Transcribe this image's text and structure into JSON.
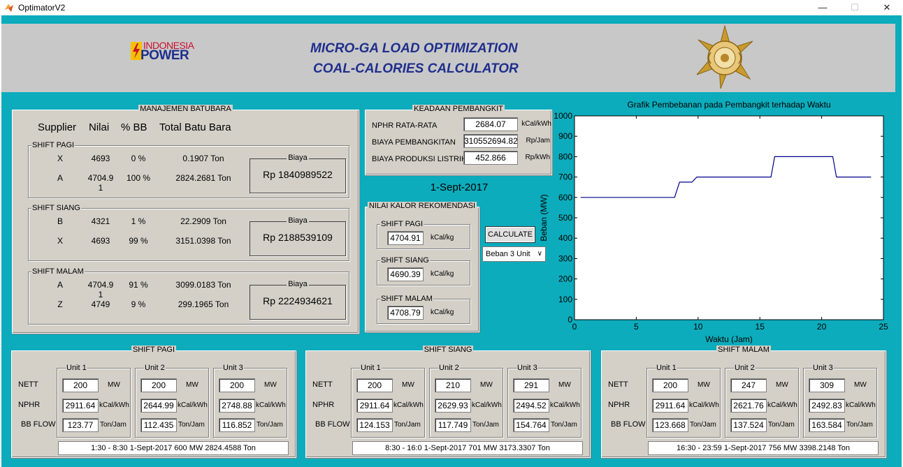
{
  "window": {
    "title": "OptimatorV2",
    "min_icon": "minimize-icon",
    "max_icon": "maximize-icon",
    "close_icon": "close-icon"
  },
  "header": {
    "logo_text_top": "INDONESIA",
    "logo_text_bottom": "POWER",
    "title_line1": "MICRO-GA LOAD OPTIMIZATION",
    "title_line2": "COAL-CALORIES CALCULATOR",
    "emblem_icon": "university-emblem-icon"
  },
  "batubara": {
    "title": "MANAJEMEN BATUBARA",
    "col_supplier": "Supplier",
    "col_nilai": "Nilai",
    "col_bb": "% BB",
    "col_total": "Total Batu Bara",
    "biaya_label": "Biaya",
    "shifts": [
      {
        "label": "SHIFT PAGI",
        "rows": [
          {
            "supplier": "X",
            "nilai": "4693",
            "bb": "0 %",
            "total": "0.1907 Ton"
          },
          {
            "supplier": "A",
            "nilai": "4704.9",
            "nilai2": "1",
            "bb": "100 %",
            "total": "2824.2681 Ton"
          }
        ],
        "biaya": "Rp 1840989522"
      },
      {
        "label": "SHIFT SIANG",
        "rows": [
          {
            "supplier": "B",
            "nilai": "4321",
            "bb": "1 %",
            "total": "22.2909 Ton"
          },
          {
            "supplier": "X",
            "nilai": "4693",
            "bb": "99 %",
            "total": "3151.0398 Ton"
          }
        ],
        "biaya": "Rp 2188539109"
      },
      {
        "label": "SHIFT MALAM",
        "rows": [
          {
            "supplier": "A",
            "nilai": "4704.9",
            "nilai2": "1",
            "bb": "91 %",
            "total": "3099.0183 Ton"
          },
          {
            "supplier": "Z",
            "nilai": "4749",
            "bb": "9 %",
            "total": "299.1965 Ton"
          }
        ],
        "biaya": "Rp 2224934621"
      }
    ]
  },
  "keadaan": {
    "title": "KEADAAN PEMBANGKIT",
    "rows": [
      {
        "label": "NPHR RATA-RATA",
        "value": "2684.07",
        "unit": "kCal/kWh"
      },
      {
        "label": "BIAYA PEMBANGKITAN",
        "value": "310552694.82",
        "unit": "Rp/Jam"
      },
      {
        "label": "BIAYA PRODUKSI LISTRIK",
        "value": "452.866",
        "unit": "Rp/kWh"
      }
    ]
  },
  "date": "1-Sept-2017",
  "kalor": {
    "title": "NILAI KALOR REKOMENDASI",
    "unit": "kCal/kg",
    "shifts": [
      {
        "label": "SHIFT PAGI",
        "value": "4704.91"
      },
      {
        "label": "SHIFT SIANG",
        "value": "4690.39"
      },
      {
        "label": "SHIFT MALAM",
        "value": "4708.79"
      }
    ]
  },
  "calculate_label": "CALCULATE",
  "beban_select": {
    "value": "Beban 3 Unit",
    "icon": "chevron-down-icon"
  },
  "chart_data": {
    "type": "line",
    "title": "Grafik Pembebanan pada Pembangkit terhadap Waktu",
    "xlabel": "Waktu (Jam)",
    "ylabel": "Beban (MW)",
    "xlim": [
      0,
      25
    ],
    "ylim": [
      0,
      1000
    ],
    "xticks": [
      "0",
      "5",
      "10",
      "15",
      "20",
      "25"
    ],
    "yticks": [
      "0",
      "100",
      "200",
      "300",
      "400",
      "500",
      "600",
      "700",
      "800",
      "900",
      "1000"
    ],
    "grid": false,
    "series": [
      {
        "color": "#00008b",
        "x": [
          0.5,
          8.1,
          8.5,
          9.5,
          9.9,
          10.1,
          15.5,
          15.9,
          16.2,
          20.4,
          20.9,
          21.2,
          24
        ],
        "y": [
          600,
          600,
          675,
          675,
          700,
          700,
          700,
          700,
          800,
          800,
          800,
          700,
          700
        ]
      }
    ]
  },
  "bottom": {
    "labels": {
      "nett": "NETT",
      "nphr": "NPHR",
      "bbflow": "BB FLOW",
      "mw": "MW",
      "kcal": "kCal/kWh",
      "ton": "Ton/Jam"
    },
    "shifts": [
      {
        "title": "SHIFT PAGI",
        "units": [
          {
            "label": "Unit 1",
            "nett": "200",
            "nphr": "2911.64",
            "bb": "123.77"
          },
          {
            "label": "Unit 2",
            "nett": "200",
            "nphr": "2644.99",
            "bb": "112.435"
          },
          {
            "label": "Unit 3",
            "nett": "200",
            "nphr": "2748.88",
            "bb": "116.852"
          }
        ],
        "summary": "1:30 - 8:30   1-Sept-2017   600 MW   2824.4588 Ton"
      },
      {
        "title": "SHIFT SIANG",
        "units": [
          {
            "label": "Unit 1",
            "nett": "200",
            "nphr": "2911.64",
            "bb": "124.153"
          },
          {
            "label": "Unit 2",
            "nett": "210",
            "nphr": "2629.93",
            "bb": "117.749"
          },
          {
            "label": "Unit 3",
            "nett": "291",
            "nphr": "2494.52",
            "bb": "154.764"
          }
        ],
        "summary": "8:30 - 16:0   1-Sept-2017   701 MW   3173.3307 Ton"
      },
      {
        "title": "SHIFT MALAM",
        "units": [
          {
            "label": "Unit 1",
            "nett": "200",
            "nphr": "2911.64",
            "bb": "123.668"
          },
          {
            "label": "Unit 2",
            "nett": "247",
            "nphr": "2621.76",
            "bb": "137.524"
          },
          {
            "label": "Unit 3",
            "nett": "309",
            "nphr": "2492.83",
            "bb": "163.584"
          }
        ],
        "summary": "16:30 - 23:59   1-Sept-2017   756 MW   3398.2148 Ton"
      }
    ]
  }
}
